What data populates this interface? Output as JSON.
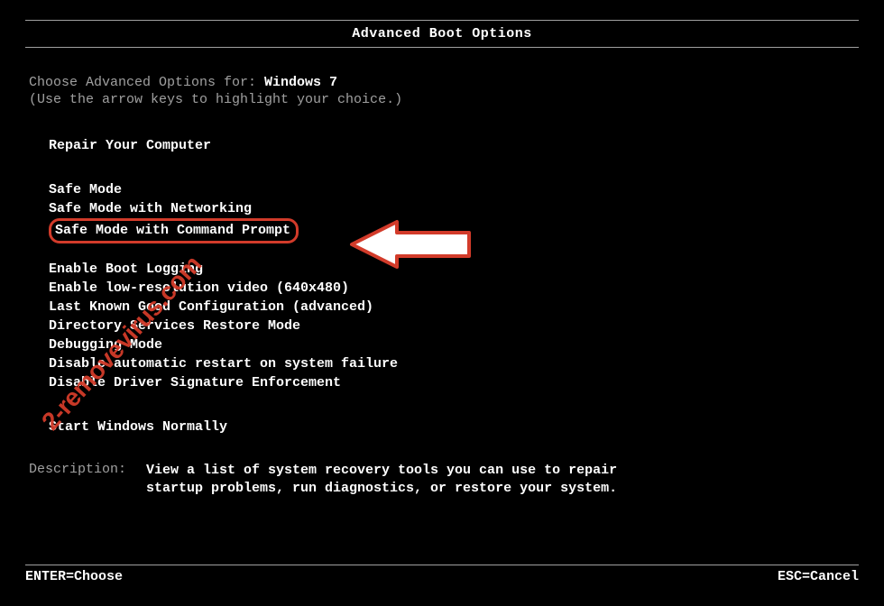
{
  "title": "Advanced Boot Options",
  "choose_prefix": "Choose Advanced Options for: ",
  "os_name": "Windows 7",
  "hint": "(Use the arrow keys to highlight your choice.)",
  "group1": [
    "Repair Your Computer"
  ],
  "group2": [
    "Safe Mode",
    "Safe Mode with Networking"
  ],
  "highlighted": "Safe Mode with Command Prompt",
  "group3": [
    "Enable Boot Logging",
    "Enable low-resolution video (640x480)",
    "Last Known Good Configuration (advanced)",
    "Directory Services Restore Mode",
    "Debugging Mode",
    "Disable automatic restart on system failure",
    "Disable Driver Signature Enforcement"
  ],
  "group4": [
    "Start Windows Normally"
  ],
  "description_label": "Description:",
  "description_text": "View a list of system recovery tools you can use to repair startup problems, run diagnostics, or restore your system.",
  "footer_left": "ENTER=Choose",
  "footer_right": "ESC=Cancel",
  "watermark": "2-removevirus.com",
  "colors": {
    "highlight_border": "#d23b2a",
    "text_bright": "#ffffff",
    "text_dim": "#a0a0a0",
    "background": "#000000"
  }
}
